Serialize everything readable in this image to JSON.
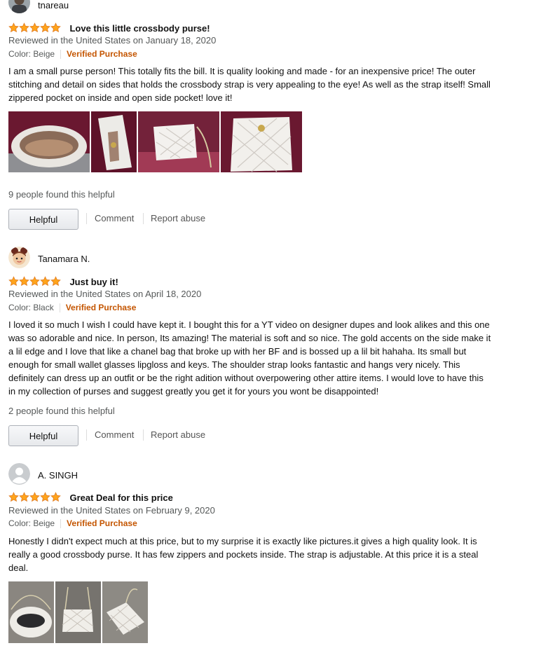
{
  "colors": {
    "star": "#ffa41c",
    "star_stroke": "#de7921",
    "verified": "#c45500",
    "secondary_text": "#565959"
  },
  "reviews": [
    {
      "username": "tnareau",
      "avatar_icon": "user-photo-avatar",
      "rating": 5,
      "title": "Love this little crossbody purse!",
      "date": "Reviewed in the United States on January 18, 2020",
      "color_label": "Color: Beige",
      "verified": "Verified Purchase",
      "body": "I am a small purse person! This totally fits the bill. It is quality looking and made - for an inexpensive price! The outer stitching and detail on sides that holds the crossbody strap is very appealing to the eye! As well as the strap itself! Small zippered pocket on inside and open side pocket! love it!",
      "image_count": 4,
      "helpful_count": "9 people found this helpful",
      "helpful_label": "Helpful",
      "comment_label": "Comment",
      "report_label": "Report abuse"
    },
    {
      "username": "Tanamara N.",
      "avatar_icon": "cartoon-girl-avatar",
      "rating": 5,
      "title": "Just buy it!",
      "date": "Reviewed in the United States on April 18, 2020",
      "color_label": "Color: Black",
      "verified": "Verified Purchase",
      "body": "I loved it so much I wish I could have kept it. I bought this for a YT video on designer dupes and look alikes and this one was so adorable and nice. In person, Its amazing! The material is soft and so nice. The gold accents on the side make it a lil edge and I love that like a chanel bag that broke up with her BF and is bossed up a lil bit hahaha. Its small but enough for small wallet glasses lipgloss and keys. The shoulder strap looks fantastic and hangs very nicely. This definitely can dress up an outfit or be the right adition without overpowering other attire items. I would love to have this in my collection of purses and suggest greatly you get it for yours you wont be disappointed!",
      "image_count": 0,
      "helpful_count": "2 people found this helpful",
      "helpful_label": "Helpful",
      "comment_label": "Comment",
      "report_label": "Report abuse"
    },
    {
      "username": "A. SINGH",
      "avatar_icon": "default-user-avatar",
      "rating": 5,
      "title": "Great Deal for this price",
      "date": "Reviewed in the United States on February 9, 2020",
      "color_label": "Color: Beige",
      "verified": "Verified Purchase",
      "body": "Honestly I didn't expect much at this price, but to my surprise it is exactly like pictures.it gives a high quality look. It is really a good crossbody purse. It has few zippers and pockets inside. The strap is adjustable. At this price it is a steal deal.",
      "image_count": 3
    }
  ]
}
